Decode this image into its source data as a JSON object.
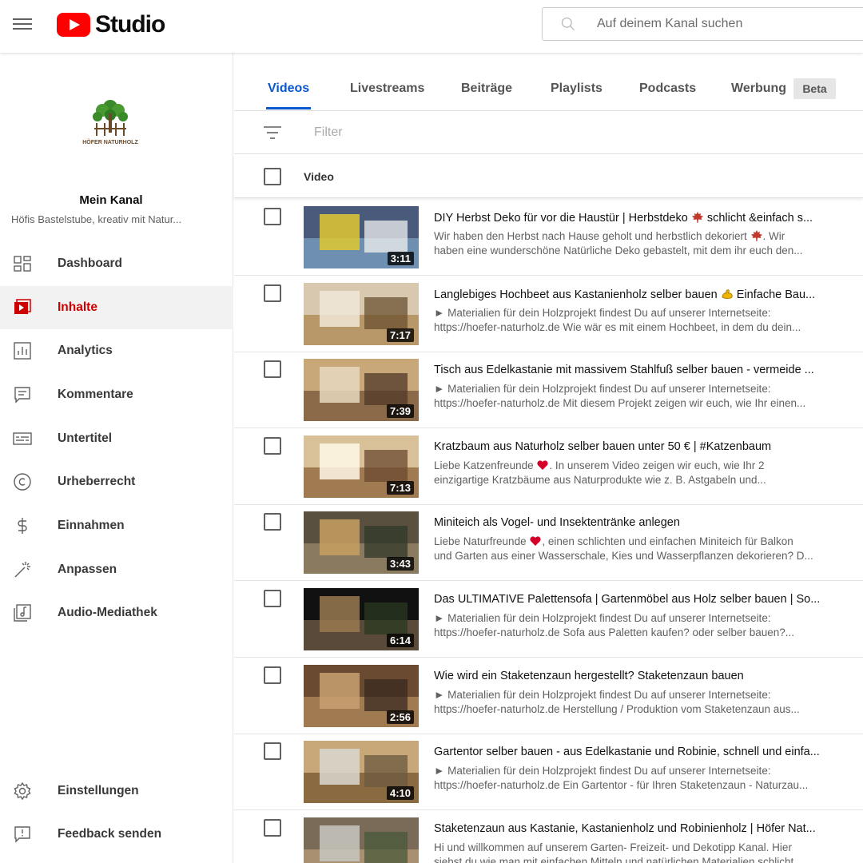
{
  "app": {
    "brand": "Studio"
  },
  "search": {
    "placeholder": "Auf deinem Kanal suchen"
  },
  "channel": {
    "title": "Mein Kanal",
    "subtitle": "Höfis Bastelstube, kreativ mit Natur...",
    "logo_text": "HÖFER NATURHOLZ"
  },
  "sidebar": {
    "items": [
      {
        "label": "Dashboard",
        "icon": "dashboard-icon"
      },
      {
        "label": "Inhalte",
        "icon": "content-icon",
        "active": true
      },
      {
        "label": "Analytics",
        "icon": "analytics-icon"
      },
      {
        "label": "Kommentare",
        "icon": "comments-icon"
      },
      {
        "label": "Untertitel",
        "icon": "subtitles-icon"
      },
      {
        "label": "Urheberrecht",
        "icon": "copyright-icon"
      },
      {
        "label": "Einnahmen",
        "icon": "dollar-icon"
      },
      {
        "label": "Anpassen",
        "icon": "magic-wand-icon"
      },
      {
        "label": "Audio-Mediathek",
        "icon": "audio-library-icon"
      }
    ],
    "bottom_items": [
      {
        "label": "Einstellungen",
        "icon": "gear-icon"
      },
      {
        "label": "Feedback senden",
        "icon": "feedback-icon"
      }
    ]
  },
  "tabs": [
    "Videos",
    "Livestreams",
    "Beiträge",
    "Playlists",
    "Podcasts",
    "Werbung"
  ],
  "tab_badge": "Beta",
  "filter": {
    "placeholder": "Filter"
  },
  "table": {
    "column_video": "Video"
  },
  "colors": {
    "accent": "#0b57d0",
    "brand_red": "#ff0000",
    "active_nav": "#cc0000"
  },
  "videos": [
    {
      "title": "DIY Herbst Deko für vor die Haustür | Herbstdeko",
      "title_after": " schlicht &einfach s...",
      "desc1": "Wir haben den Herbst nach Hause geholt und herbstlich dekoriert",
      "desc1_after": ". Wir",
      "desc2": "haben eine wunderschöne Natürliche Deko gebastelt, mit dem ihr euch den...",
      "duration": "3:11"
    },
    {
      "title": "Langlebiges Hochbeet aus Kastanienholz selber bauen",
      "title_after": " Einfache Bau...",
      "desc1": "► Materialien für dein Holzprojekt findest Du auf unserer Internetseite:",
      "desc1_after": "",
      "desc2": "https://hoefer-naturholz.de Wie wär es mit einem Hochbeet, in dem du dein...",
      "duration": "7:17"
    },
    {
      "title": "Tisch aus Edelkastanie mit massivem Stahlfuß selber bauen - vermeide ...",
      "title_after": "",
      "desc1": "► Materialien für dein Holzprojekt findest Du auf unserer Internetseite:",
      "desc1_after": "",
      "desc2": "https://hoefer-naturholz.de Mit diesem Projekt zeigen wir euch, wie Ihr einen...",
      "duration": "7:39"
    },
    {
      "title": "Kratzbaum aus Naturholz selber bauen unter 50 € | #Katzenbaum",
      "title_after": "",
      "desc1": "Liebe Katzenfreunde",
      "desc1_after": ". In unserem Video zeigen wir euch, wie Ihr 2",
      "desc2": "einzigartige Kratzbäume aus Naturprodukte wie z. B. Astgabeln und...",
      "duration": "7:13"
    },
    {
      "title": "Miniteich als Vogel- und Insektentränke anlegen",
      "title_after": "",
      "desc1": "Liebe Naturfreunde",
      "desc1_after": ", einen schlichten und einfachen Miniteich für Balkon",
      "desc2": "und Garten aus einer Wasserschale, Kies und Wasserpflanzen dekorieren? D...",
      "duration": "3:43"
    },
    {
      "title": "Das ULTIMATIVE Palettensofa | Gartenmöbel aus Holz selber bauen | So...",
      "title_after": "",
      "desc1": "► Materialien für dein Holzprojekt findest Du auf unserer Internetseite:",
      "desc1_after": "",
      "desc2": "https://hoefer-naturholz.de Sofa aus Paletten kaufen? oder selber bauen?...",
      "duration": "6:14"
    },
    {
      "title": "Wie wird ein Staketenzaun hergestellt? Staketenzaun bauen",
      "title_after": "",
      "desc1": "► Materialien für dein Holzprojekt findest Du auf unserer Internetseite:",
      "desc1_after": "",
      "desc2": "https://hoefer-naturholz.de Herstellung / Produktion vom Staketenzaun aus...",
      "duration": "2:56"
    },
    {
      "title": "Gartentor selber bauen - aus Edelkastanie und Robinie, schnell und einfa...",
      "title_after": "",
      "desc1": "► Materialien für dein Holzprojekt findest Du auf unserer Internetseite:",
      "desc1_after": "",
      "desc2": "https://hoefer-naturholz.de Ein Gartentor - für Ihren Staketenzaun - Naturzau...",
      "duration": "4:10"
    },
    {
      "title": "Staketenzaun aus Kastanie, Kastanienholz und Robinienholz | Höfer Nat...",
      "title_after": "",
      "desc1": "Hi und willkommen auf unserem Garten- Freizeit- und Dekotipp Kanal. Hier",
      "desc1_after": "",
      "desc2": "siehst du wie man mit einfachen Mitteln und natürlichen Materialien schlicht...",
      "duration": ""
    }
  ]
}
